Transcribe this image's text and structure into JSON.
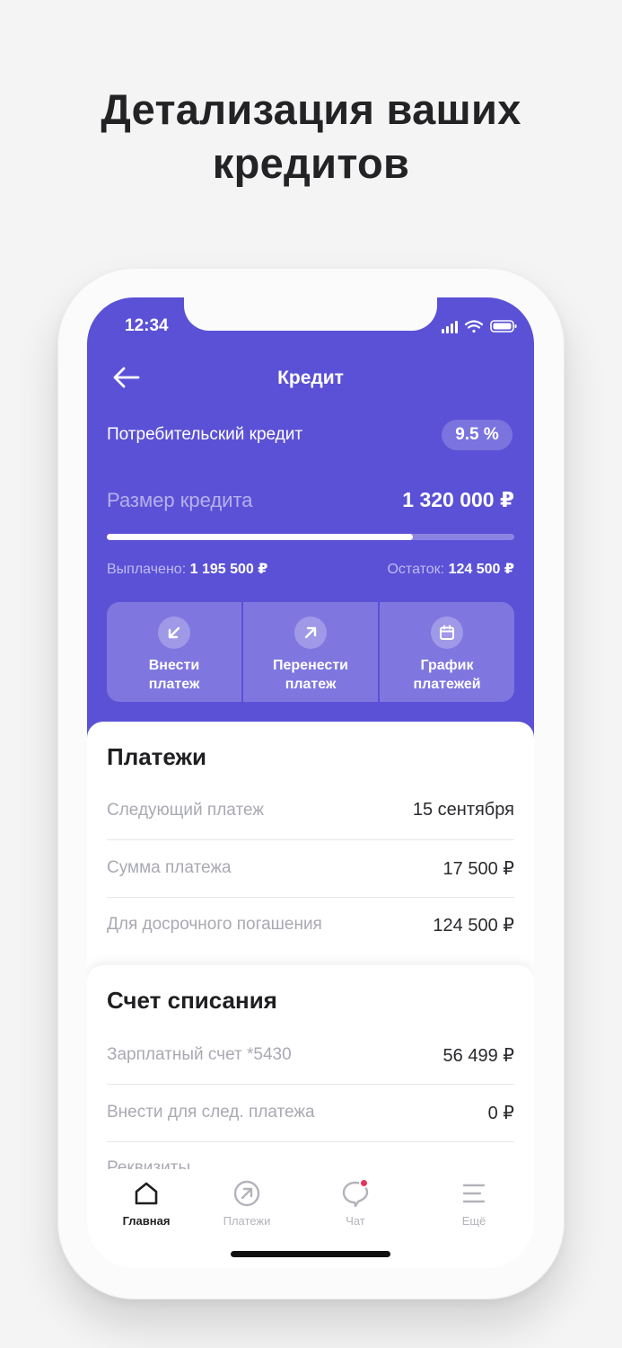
{
  "promo": {
    "headline_line1": "Детализация ваших",
    "headline_line2": "кредитов"
  },
  "status_bar": {
    "time": "12:34"
  },
  "header": {
    "title": "Кредит",
    "back_icon": "arrow-left-icon"
  },
  "loan": {
    "name": "Потребительский кредит",
    "rate": "9.5 %",
    "size_label": "Размер кредита",
    "size_value": "1 320 000 ₽",
    "paid_label": "Выплачено:",
    "paid_value": "1 195 500 ₽",
    "remaining_label": "Остаток:",
    "remaining_value": "124 500 ₽",
    "paid_fraction": 0.75
  },
  "actions": [
    {
      "label": "Внести\nплатеж",
      "icon": "arrow-down-left-icon"
    },
    {
      "label": "Перенести\nплатеж",
      "icon": "arrow-up-right-icon"
    },
    {
      "label": "График\nплатежей",
      "icon": "calendar-icon"
    }
  ],
  "payments": {
    "title": "Платежи",
    "rows": [
      {
        "label": "Следующий платеж",
        "value": "15 сентября"
      },
      {
        "label": "Сумма платежа",
        "value": "17 500 ₽"
      },
      {
        "label": "Для досрочного погашения",
        "value": "124 500 ₽"
      }
    ]
  },
  "account": {
    "title": "Счет списания",
    "rows": [
      {
        "label": "Зарплатный счет *5430",
        "value": "56 499 ₽"
      },
      {
        "label": "Внести для след. платежа",
        "value": "0 ₽"
      }
    ],
    "requisites_label": "Реквизиты"
  },
  "tabbar": {
    "items": [
      {
        "label": "Главная",
        "icon": "home-icon",
        "active": true
      },
      {
        "label": "Платежи",
        "icon": "payments-icon",
        "active": false
      },
      {
        "label": "Чат",
        "icon": "chat-icon",
        "active": false
      },
      {
        "label": "Ещё",
        "icon": "menu-icon",
        "active": false
      }
    ]
  },
  "colors": {
    "accent": "#5b51d6",
    "background": "#f4f4f5",
    "notification": "#e8325a"
  }
}
